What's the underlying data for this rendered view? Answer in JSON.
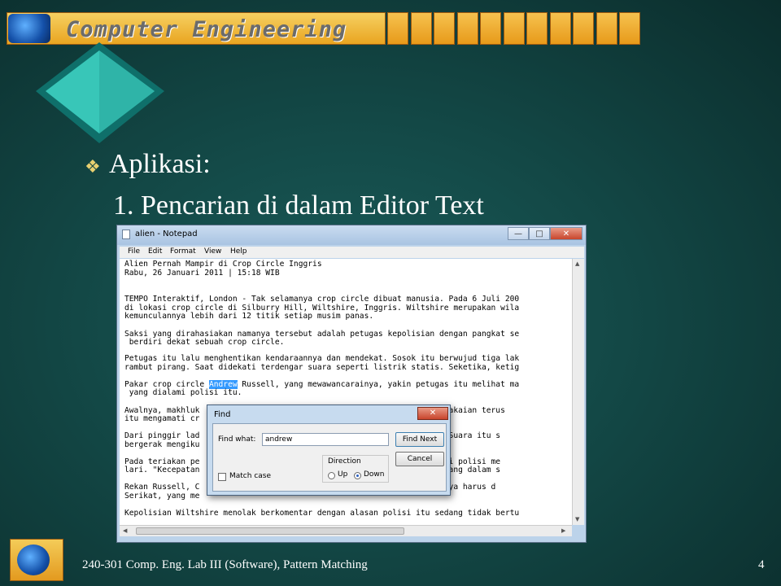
{
  "slide": {
    "header_title": "Computer Engineering",
    "heading": "Aplikasi:",
    "subheading": "1. Pencarian di dalam Editor Text",
    "footer": "240-301 Comp. Eng. Lab III (Software), Pattern Matching",
    "page_number": "4",
    "bullet_icon": "diamond-bullet-icon"
  },
  "notepad": {
    "title": "alien - Notepad",
    "window_buttons": {
      "minimize": "—",
      "maximize": "□",
      "close": "✕"
    },
    "menu": [
      "File",
      "Edit",
      "Format",
      "View",
      "Help"
    ],
    "lines": [
      "Alien Pernah Mampir di Crop Circle Inggris",
      "Rabu, 26 Januari 2011 | 15:18 WIB",
      "",
      "TEMPO Interaktif, London - Tak selamanya crop circle dibuat manusia. Pada 6 Juli 200",
      "di lokasi crop circle di Silburry Hill, Wiltshire, Inggris. Wiltshire merupakan wila",
      "kemunculannya lebih dari 12 titik setiap musim panas.",
      "",
      "Saksi yang dirahasiakan namanya tersebut adalah petugas kepolisian dengan pangkat se",
      " berdiri dekat sebuah crop circle.",
      "",
      "Petugas itu lalu menghentikan kendaraannya dan mendekat. Sosok itu berwujud tiga lak",
      "rambut pirang. Saat didekati terdengar suara seperti listrik statis. Seketika, ketig",
      "",
      "",
      " yang dialami polisi itu.",
      "",
      "Awalnya, makhluk                                          engenakan pakaian terus",
      "itu mengamati cr",
      "",
      "Dari pinggir lad                                          k statis. \"Suara itu s",
      "bergerak mengiku",
      "",
      "Pada teriakan pe                                          amun saat si polisi me",
      "lari. \"Kecepatan                                          eka menghilang dalam s",
      "",
      "Rekan Russell, C                                          \"Informasinya harus d",
      "Serikat, yang me",
      "",
      "Kepolisian Wiltshire menolak berkomentar dengan alasan polisi itu sedang tidak bertu"
    ],
    "highlight_line": {
      "before": "Pakar crop circle ",
      "match": "Andrew",
      "after": " Russell, yang mewawancarainya, yakin petugas itu melihat ma"
    }
  },
  "find_dialog": {
    "title": "Find",
    "close_label": "✕",
    "find_what_label": "Find what:",
    "find_what_value": "andrew",
    "find_next_label": "Find Next",
    "cancel_label": "Cancel",
    "direction_label": "Direction",
    "up_label": "Up",
    "down_label": "Down",
    "direction_selected": "Down",
    "match_case_label": "Match case",
    "match_case_checked": false
  }
}
